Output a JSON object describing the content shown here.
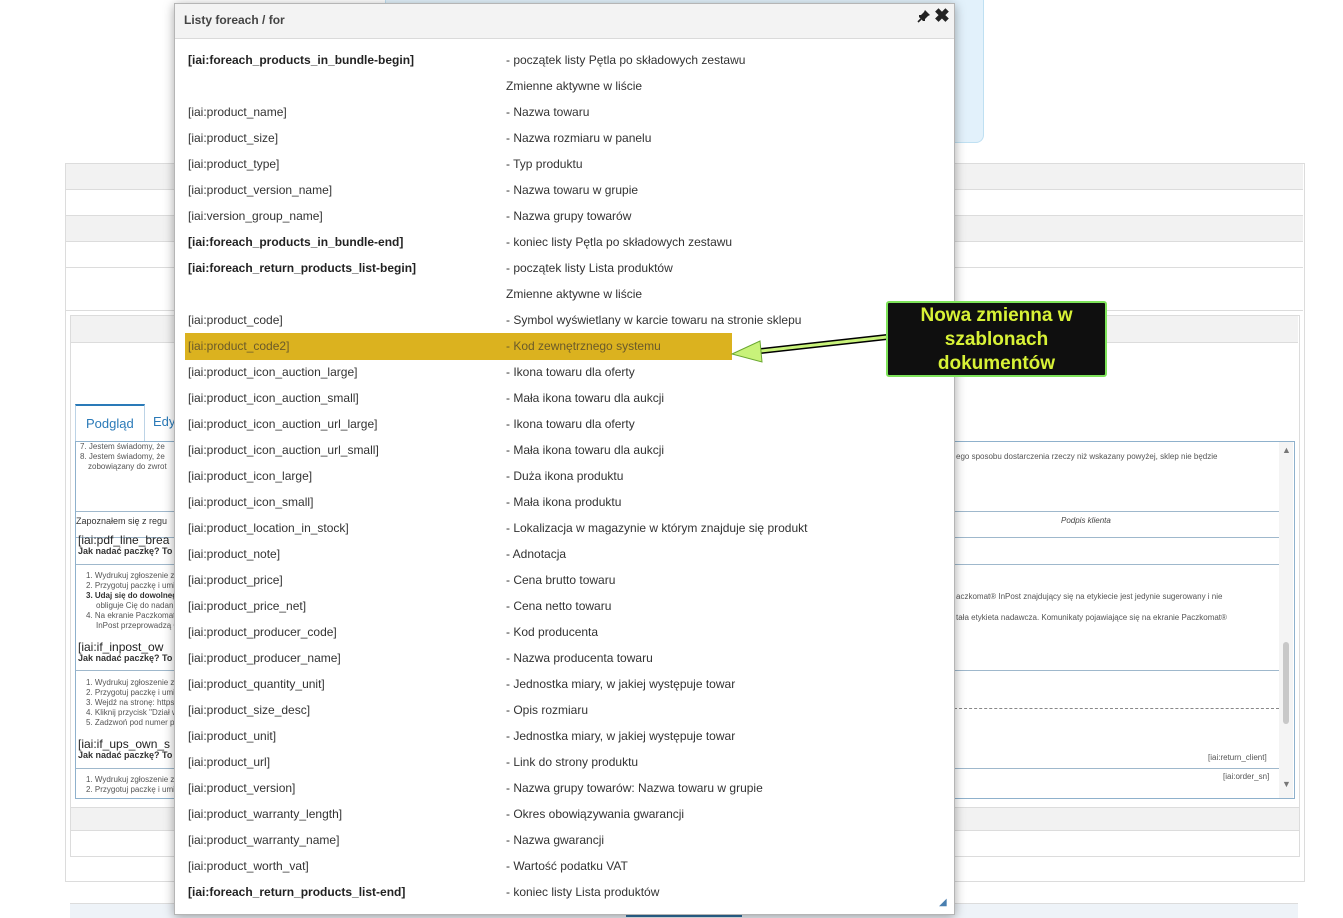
{
  "dialog": {
    "title": "Listy foreach / for",
    "icons": {
      "pin": "pin-icon",
      "close": "close-icon",
      "resize": "resize-grip-icon"
    },
    "rows": [
      {
        "code": "[iai:foreach_products_in_bundle-begin]",
        "desc": "- początek listy Pętla po składowych zestawu",
        "bold": true
      },
      {
        "code": "",
        "desc": "Zmienne aktywne w liście"
      },
      {
        "code": "[iai:product_name]",
        "desc": "- Nazwa towaru"
      },
      {
        "code": "[iai:product_size]",
        "desc": "- Nazwa rozmiaru w panelu"
      },
      {
        "code": "[iai:product_type]",
        "desc": "- Typ produktu"
      },
      {
        "code": "[iai:product_version_name]",
        "desc": "- Nazwa towaru w grupie"
      },
      {
        "code": "[iai:version_group_name]",
        "desc": "- Nazwa grupy towarów"
      },
      {
        "code": "[iai:foreach_products_in_bundle-end]",
        "desc": "- koniec listy Pętla po składowych zestawu",
        "bold": true
      },
      {
        "code": "[iai:foreach_return_products_list-begin]",
        "desc": "- początek listy Lista produktów",
        "bold": true
      },
      {
        "code": "",
        "desc": "Zmienne aktywne w liście"
      },
      {
        "code": "[iai:product_code]",
        "desc": "- Symbol wyświetlany w karcie towaru na stronie sklepu"
      },
      {
        "code": "[iai:product_code2]",
        "desc": "- Kod zewnętrznego systemu",
        "highlight": true
      },
      {
        "code": "[iai:product_icon_auction_large]",
        "desc": "- Ikona towaru dla oferty"
      },
      {
        "code": "[iai:product_icon_auction_small]",
        "desc": "- Mała ikona towaru dla aukcji"
      },
      {
        "code": "[iai:product_icon_auction_url_large]",
        "desc": "- Ikona towaru dla oferty"
      },
      {
        "code": "[iai:product_icon_auction_url_small]",
        "desc": "- Mała ikona towaru dla aukcji"
      },
      {
        "code": "[iai:product_icon_large]",
        "desc": "- Duża ikona produktu"
      },
      {
        "code": "[iai:product_icon_small]",
        "desc": "- Mała ikona produktu"
      },
      {
        "code": "[iai:product_location_in_stock]",
        "desc": "- Lokalizacja w magazynie w którym znajduje się produkt"
      },
      {
        "code": "[iai:product_note]",
        "desc": "- Adnotacja"
      },
      {
        "code": "[iai:product_price]",
        "desc": "- Cena brutto towaru"
      },
      {
        "code": "[iai:product_price_net]",
        "desc": "- Cena netto towaru"
      },
      {
        "code": "[iai:product_producer_code]",
        "desc": "- Kod producenta"
      },
      {
        "code": "[iai:product_producer_name]",
        "desc": "- Nazwa producenta towaru"
      },
      {
        "code": "[iai:product_quantity_unit]",
        "desc": "- Jednostka miary, w jakiej występuje towar"
      },
      {
        "code": "[iai:product_size_desc]",
        "desc": "- Opis rozmiaru"
      },
      {
        "code": "[iai:product_unit]",
        "desc": "- Jednostka miary, w jakiej występuje towar"
      },
      {
        "code": "[iai:product_url]",
        "desc": "- Link do strony produktu"
      },
      {
        "code": "[iai:product_version]",
        "desc": "- Nazwa grupy towarów: Nazwa towaru w grupie"
      },
      {
        "code": "[iai:product_warranty_length]",
        "desc": "- Okres obowiązywania gwarancji"
      },
      {
        "code": "[iai:product_warranty_name]",
        "desc": "- Nazwa gwarancji"
      },
      {
        "code": "[iai:product_worth_vat]",
        "desc": "- Wartość podatku VAT"
      },
      {
        "code": "[iai:foreach_return_products_list-end]",
        "desc": "- koniec listy Lista produktów",
        "bold": true
      }
    ]
  },
  "callout": {
    "lines": [
      "Nowa zmienna w",
      "szablonach",
      "dokumentów"
    ]
  },
  "background": {
    "tabs": {
      "preview": "Podgląd",
      "edit": "Edy"
    },
    "preview_texts": {
      "l1": "7. Jestem świadomy, że",
      "l2": "8. Jestem świadomy, że",
      "l3": "zobowiązany do zwrot",
      "right1": "ego sposobu dostarczenia rzeczy niż wskazany powyżej, sklep nie będzie",
      "signature": "Podpis klienta",
      "zapoznalem": "Zapoznałem się z regu",
      "pdf_line": "[iai:pdf_line_brea",
      "jak1": "Jak nadać paczkę? To",
      "s1a": "1. Wydrukuj zgłoszenie z",
      "s1b": "2. Przygotuj paczkę i umi",
      "s1c": "3. Udaj się do dowolneg",
      "s1d": "obliguje Cię do nadan",
      "s1e": "4. Na ekranie Paczkomat",
      "s1f": "InPost przeprowadzą C",
      "right2": "aczkomat® InPost znajdujący się na etykiecie jest jedynie sugerowany i nie",
      "right3": "tała etykieta nadawcza. Komunikaty pojawiające się na ekranie Paczkomat®",
      "inpost": "[iai:if_inpost_ow",
      "jak2": "Jak nadać paczkę? To",
      "s2a": "1. Wydrukuj zgłoszenie z",
      "s2b": "2. Przygotuj paczkę i umi",
      "s2c": "3. Wejdź na stronę: https",
      "s2d": "4. Kliknij przycisk \"Dział w",
      "s2e": "5. Zadzwoń pod numer p",
      "ups": "[iai:if_ups_own_s",
      "jak3": "Jak nadać paczkę? To",
      "s3a": "1. Wydrukuj zgłoszenie z",
      "s3b": "2. Przygotuj paczkę i umi",
      "return_client": "[iai:return_client]",
      "order_sn": "[iai:order_sn]"
    }
  }
}
